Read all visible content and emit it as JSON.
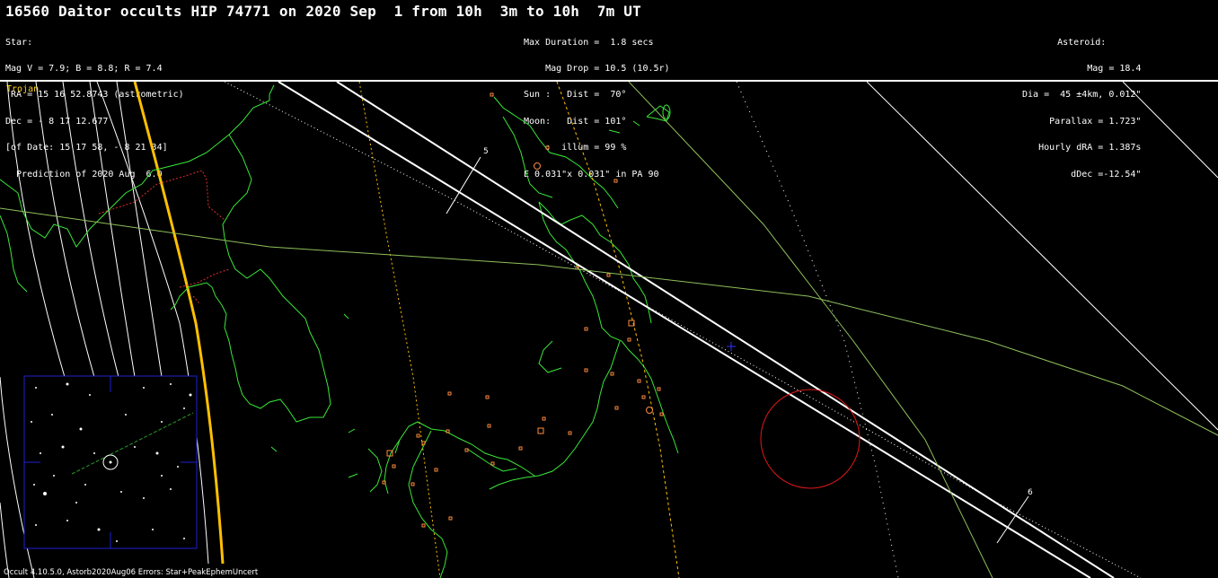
{
  "title": "16560 Daitor occults HIP 74771 on 2020 Sep  1 from 10h  3m to 10h  7m UT",
  "star_block": [
    "Star:",
    "Mag V = 7.9; B = 8.8; R = 7.4",
    " RA = 15 16 52.8743 (astrometric)",
    "Dec = - 8 17 12.677",
    "[of Date: 15 17 58, - 8 21 34]",
    "  Prediction of 2020 Aug  6.0"
  ],
  "event_block": [
    "Max Duration =  1.8 secs",
    "    Mag Drop = 10.5 (10.5r)",
    "Sun :   Dist =  70°",
    "Moon:   Dist = 101°",
    "    :  illum = 99 %",
    "E 0.031\"x 0.031\" in PA 90"
  ],
  "asteroid_block": [
    "Asteroid:",
    "Mag = 18.4",
    "Dia =  45 ±4km, 0.012\"",
    "Parallax = 1.723\"",
    "Hourly dRA = 1.387s",
    "dDec =-12.54\""
  ],
  "map_label": "Trojan",
  "time_ticks": [
    "5",
    "6"
  ],
  "footer": "Occult 4.10.5.0, Astorb2020Aug06  Errors: Star+PeakEphemUncert",
  "colors": {
    "background": "#000000",
    "coastline": "#38e838",
    "path": "#ffffff",
    "sun_terminator": "#ffc000",
    "border": "#e03030",
    "city": "#ff8c40",
    "uncertainty_circle": "#e01818",
    "finder_frame": "#2020d0"
  }
}
